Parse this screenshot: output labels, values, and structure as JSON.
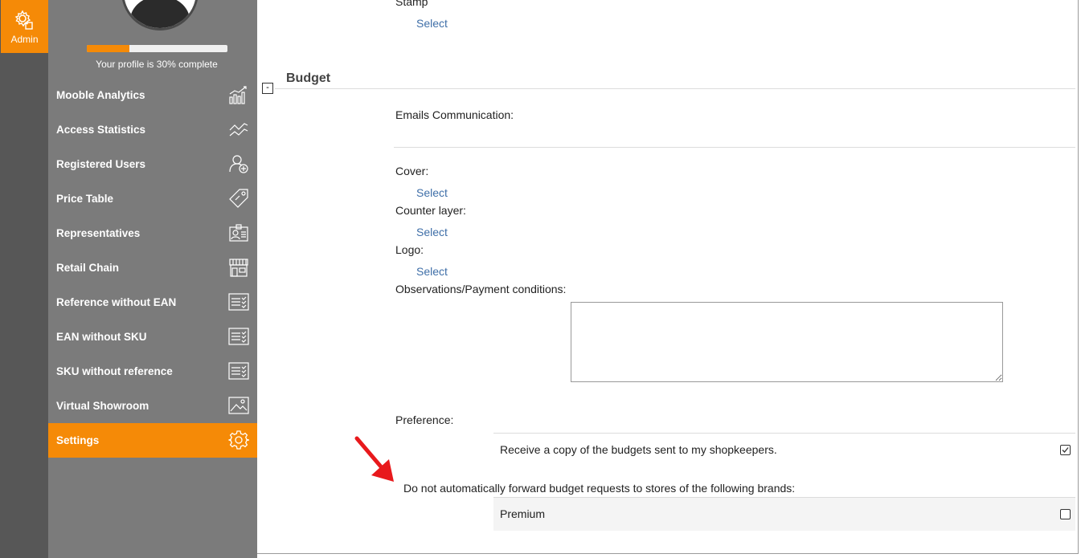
{
  "rail": {
    "admin_label": "Admin"
  },
  "profile": {
    "completion_text": "Your profile is 30% complete",
    "completion_fraction": 0.3
  },
  "menu": [
    {
      "label": "Mooble Analytics",
      "icon": "bar-chart-icon"
    },
    {
      "label": "Access Statistics",
      "icon": "trend-line-icon"
    },
    {
      "label": "Registered Users",
      "icon": "add-user-icon"
    },
    {
      "label": "Price Table",
      "icon": "price-tag-icon"
    },
    {
      "label": "Representatives",
      "icon": "id-card-icon"
    },
    {
      "label": "Retail Chain",
      "icon": "storefront-icon"
    },
    {
      "label": "Reference without EAN",
      "icon": "checklist-icon"
    },
    {
      "label": "EAN without SKU",
      "icon": "checklist-icon"
    },
    {
      "label": "SKU without reference",
      "icon": "checklist-icon"
    },
    {
      "label": "Virtual Showroom",
      "icon": "image-icon"
    },
    {
      "label": "Settings",
      "icon": "gear-icon",
      "active": true
    }
  ],
  "main": {
    "stamp_label": "Stamp",
    "select_label": "Select",
    "collapse_symbol": "-",
    "section_title": "Budget",
    "emails_label": "Emails Communication:",
    "cover_label": "Cover:",
    "counter_layer_label": "Counter layer:",
    "logo_label": "Logo:",
    "observations_label": "Observations/Payment conditions:",
    "observations_value": "",
    "preference_label": "Preference:",
    "receive_copy_label": "Receive a copy of the budgets sent to my shopkeepers.",
    "receive_copy_checked": true,
    "no_forward_label": "Do not automatically forward budget requests to stores of the following brands:",
    "brands": [
      {
        "name": "Premium",
        "checked": false
      }
    ]
  },
  "colors": {
    "accent": "#f58a07",
    "sidebar": "#7b7b7b",
    "rail": "#575757",
    "link": "#3f6fa8",
    "annotation_arrow": "#e8191c"
  }
}
